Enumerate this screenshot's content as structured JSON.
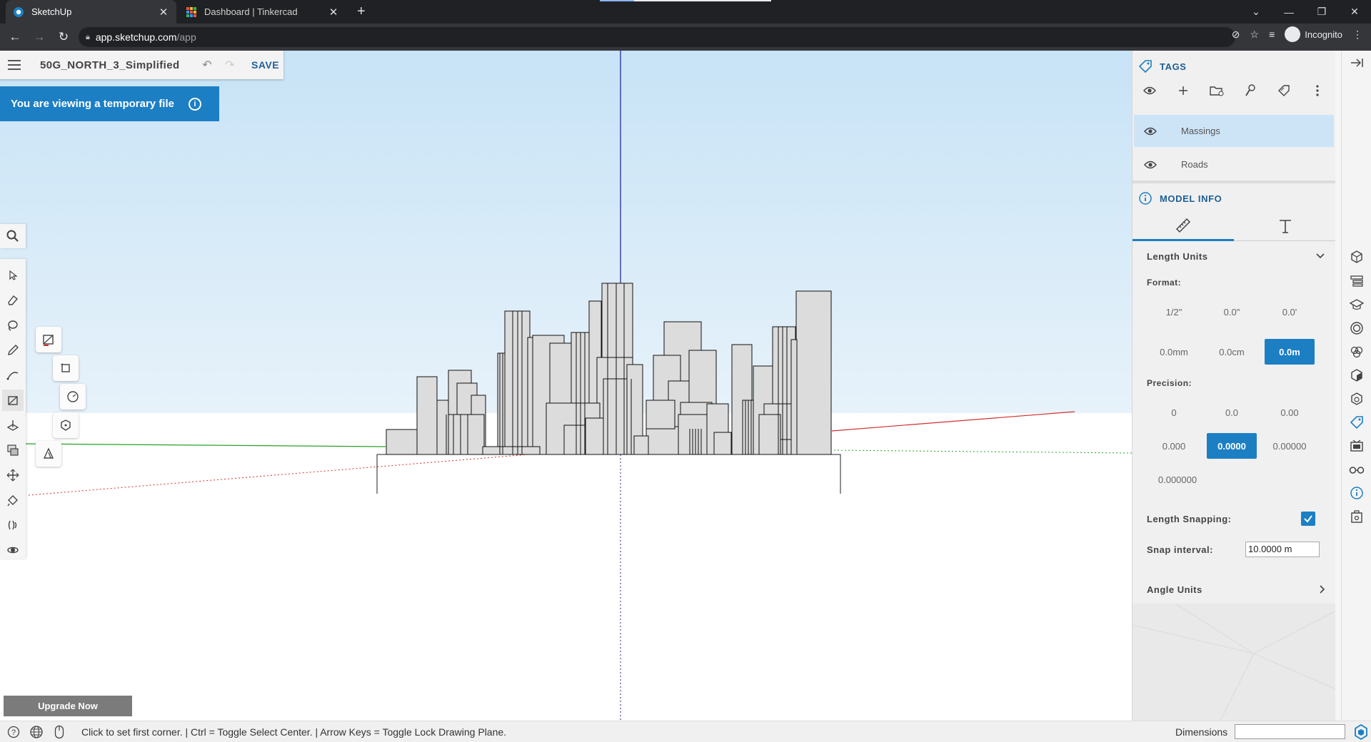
{
  "browser": {
    "tabs": [
      {
        "title": "SketchUp"
      },
      {
        "title": "Dashboard | Tinkercad"
      }
    ],
    "url_host": "app.sketchup.com",
    "url_path": "/app",
    "profile_label": "Incognito"
  },
  "file": {
    "name": "50G_NORTH_3_Simplified",
    "save_label": "SAVE"
  },
  "banner": {
    "text": "You are viewing a temporary file"
  },
  "upgrade_label": "Upgrade Now",
  "status": {
    "hint": "Click to set first corner. | Ctrl = Toggle Select Center. | Arrow Keys = Toggle Lock Drawing Plane.",
    "dimensions_label": "Dimensions",
    "dimensions_value": ""
  },
  "tags_panel": {
    "title": "TAGS",
    "tags": [
      {
        "name": "Massings",
        "selected": true
      },
      {
        "name": "Roads",
        "selected": false
      }
    ]
  },
  "model_info": {
    "title": "MODEL INFO",
    "length_units": {
      "title": "Length Units",
      "format_label": "Format:",
      "format_options": [
        "1/2\"",
        "0.0\"",
        "0.0'",
        "0.0mm",
        "0.0cm",
        "0.0m"
      ],
      "format_selected": "0.0m",
      "precision_label": "Precision:",
      "precision_options": [
        "0",
        "0.0",
        "0.00",
        "0.000",
        "0.0000",
        "0.00000",
        "0.000000"
      ],
      "precision_selected": "0.0000",
      "snapping_label": "Length Snapping:",
      "snapping_enabled": true,
      "snap_interval_label": "Snap interval:",
      "snap_interval_value": "10.0000 m"
    },
    "angle_units_title": "Angle Units"
  },
  "colors": {
    "accent": "#1c7fc4",
    "panel_heading": "#1d5f95",
    "red_axis": "#d03030",
    "green_axis": "#2aa02a",
    "blue_axis": "#2a2a9a"
  }
}
